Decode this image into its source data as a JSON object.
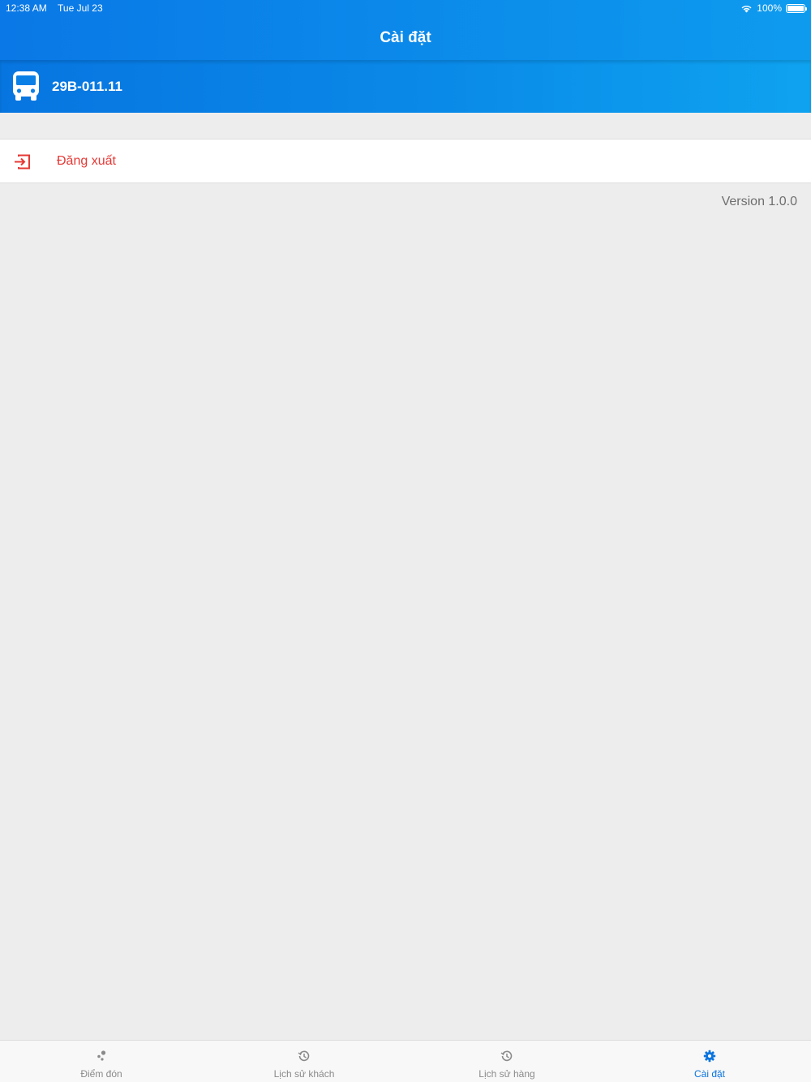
{
  "status_bar": {
    "time": "12:38 AM",
    "date": "Tue Jul 23",
    "battery": "100%",
    "battery_level": 1.0
  },
  "header": {
    "title": "Cài đặt"
  },
  "vehicle": {
    "plate": "29B-011.11",
    "icon": "bus-icon"
  },
  "menu": {
    "logout_label": "Đăng xuất",
    "logout_icon": "logout-icon",
    "logout_color": "#e53935"
  },
  "footer": {
    "version": "Version 1.0.0"
  },
  "tabs": [
    {
      "label": "Điểm đón",
      "icon": "pickup-points-icon",
      "active": false
    },
    {
      "label": "Lịch sử khách",
      "icon": "history-icon",
      "active": false
    },
    {
      "label": "Lịch sử hàng",
      "icon": "history-icon",
      "active": false
    },
    {
      "label": "Cài đặt",
      "icon": "gear-icon",
      "active": true
    }
  ],
  "colors": {
    "accent": "#0b74de",
    "header_gradient_start": "#0a78e6",
    "header_gradient_end": "#0e9bee",
    "background": "#ededed",
    "inactive_tab": "#8a8a8a"
  }
}
